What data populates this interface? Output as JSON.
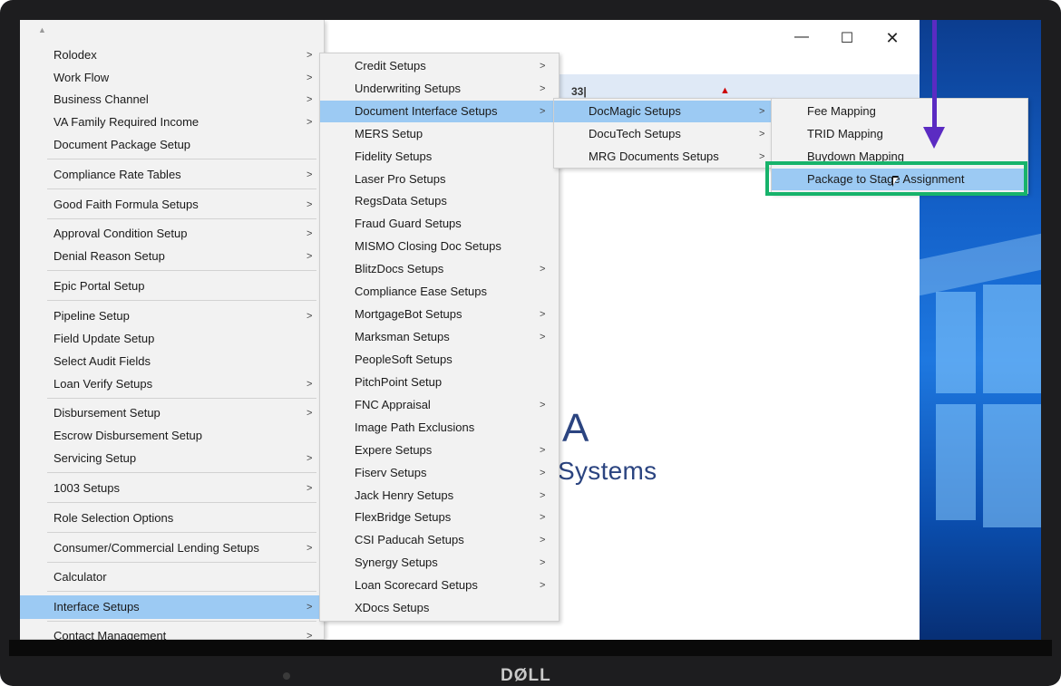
{
  "window_controls": {
    "minimize": "—",
    "maximize": "☐",
    "close": "✕"
  },
  "app_band": {
    "text": "33|",
    "icon": "alert-icon"
  },
  "logo": {
    "letter": "A",
    "text": "Systems"
  },
  "brand": {
    "name": "DØLL"
  },
  "menu_main": {
    "scroll_up": "▲",
    "items": [
      {
        "label": "Rolodex",
        "arrow": ">"
      },
      {
        "label": "Work Flow",
        "arrow": ">"
      },
      {
        "label": "Business Channel",
        "arrow": ">"
      },
      {
        "label": "VA Family Required Income",
        "arrow": ">"
      },
      {
        "label": "Document Package Setup",
        "arrow": ""
      },
      {
        "label": "Compliance Rate Tables",
        "arrow": ">"
      },
      {
        "label": "Good Faith Formula Setups",
        "arrow": ">"
      },
      {
        "label": "Approval Condition Setup",
        "arrow": ">"
      },
      {
        "label": "Denial Reason Setup",
        "arrow": ">"
      },
      {
        "label": "Epic Portal Setup",
        "arrow": ""
      },
      {
        "label": "Pipeline Setup",
        "arrow": ">"
      },
      {
        "label": "Field Update Setup",
        "arrow": ""
      },
      {
        "label": "Select Audit Fields",
        "arrow": ""
      },
      {
        "label": "Loan Verify Setups",
        "arrow": ">"
      },
      {
        "label": "Disbursement Setup",
        "arrow": ">"
      },
      {
        "label": "Escrow Disbursement Setup",
        "arrow": ""
      },
      {
        "label": "Servicing Setup",
        "arrow": ">"
      },
      {
        "label": "1003 Setups",
        "arrow": ">"
      },
      {
        "label": "Role Selection Options",
        "arrow": ""
      },
      {
        "label": "Consumer/Commercial Lending Setups",
        "arrow": ">"
      },
      {
        "label": "Calculator",
        "arrow": ""
      },
      {
        "label": "Interface Setups",
        "arrow": ">"
      },
      {
        "label": "Contact Management",
        "arrow": ">"
      }
    ]
  },
  "menu_interface": {
    "items": [
      {
        "label": "Credit Setups",
        "arrow": ">"
      },
      {
        "label": "Underwriting Setups",
        "arrow": ">"
      },
      {
        "label": "Document Interface Setups",
        "arrow": ">"
      },
      {
        "label": "MERS Setup",
        "arrow": ""
      },
      {
        "label": "Fidelity Setups",
        "arrow": ""
      },
      {
        "label": "Laser Pro Setups",
        "arrow": ""
      },
      {
        "label": "RegsData Setups",
        "arrow": ""
      },
      {
        "label": "Fraud Guard Setups",
        "arrow": ""
      },
      {
        "label": "MISMO Closing Doc Setups",
        "arrow": ""
      },
      {
        "label": "BlitzDocs Setups",
        "arrow": ">"
      },
      {
        "label": "Compliance Ease Setups",
        "arrow": ""
      },
      {
        "label": "MortgageBot Setups",
        "arrow": ">"
      },
      {
        "label": "Marksman Setups",
        "arrow": ">"
      },
      {
        "label": "PeopleSoft Setups",
        "arrow": ""
      },
      {
        "label": "PitchPoint Setup",
        "arrow": ""
      },
      {
        "label": "FNC Appraisal",
        "arrow": ">"
      },
      {
        "label": "Image Path Exclusions",
        "arrow": ""
      },
      {
        "label": "Expere Setups",
        "arrow": ">"
      },
      {
        "label": "Fiserv Setups",
        "arrow": ">"
      },
      {
        "label": "Jack Henry Setups",
        "arrow": ">"
      },
      {
        "label": "FlexBridge Setups",
        "arrow": ">"
      },
      {
        "label": "CSI Paducah Setups",
        "arrow": ">"
      },
      {
        "label": "Synergy Setups",
        "arrow": ">"
      },
      {
        "label": "Loan Scorecard Setups",
        "arrow": ">"
      },
      {
        "label": "XDocs Setups",
        "arrow": ""
      }
    ]
  },
  "menu_document_interface": {
    "items": [
      {
        "label": "DocMagic Setups",
        "arrow": ">"
      },
      {
        "label": "DocuTech Setups",
        "arrow": ">"
      },
      {
        "label": "MRG Documents Setups",
        "arrow": ">"
      }
    ]
  },
  "menu_docmagic": {
    "items": [
      {
        "label": "Fee Mapping"
      },
      {
        "label": "TRID Mapping"
      },
      {
        "label": "Buydown Mapping"
      },
      {
        "label": "Package to Stage Assignment"
      }
    ]
  },
  "colors": {
    "highlight": "#9ccaf3",
    "callout_box": "#17b36b",
    "callout_arrow": "#5b2bc2"
  }
}
